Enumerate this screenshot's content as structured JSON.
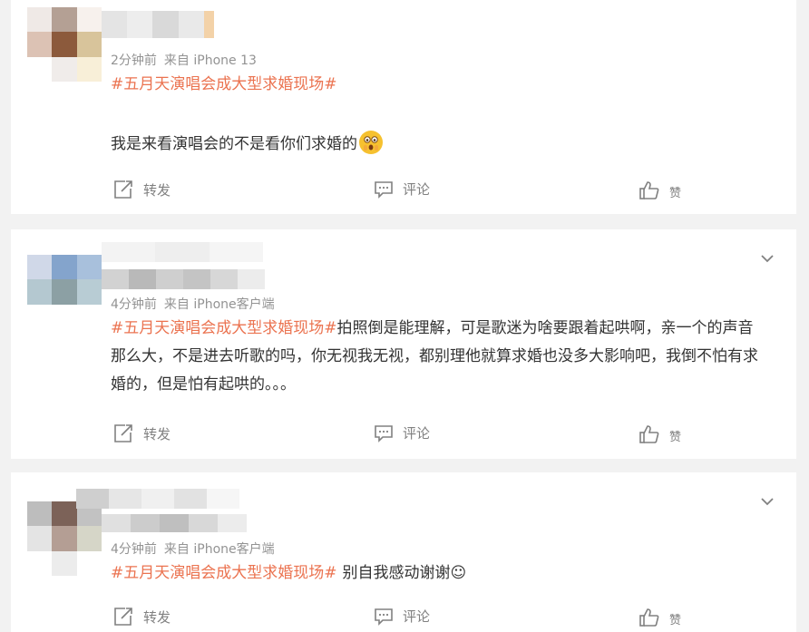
{
  "posts": [
    {
      "meta_time": "2分钟前",
      "meta_source": "来自 iPhone 13",
      "hashtag": "#五月天演唱会成大型求婚现场#",
      "text": "我是来看演唱会的不是看你们求婚的",
      "emoji": "scared-face-emoji",
      "actions": {
        "forward": "转发",
        "comment": "评论",
        "like": "赞"
      }
    },
    {
      "meta_time": "4分钟前",
      "meta_source": "来自 iPhone客户端",
      "hashtag": "#五月天演唱会成大型求婚现场#",
      "text": "拍照倒是能理解，可是歌迷为啥要跟着起哄啊，亲一个的声音那么大，不是进去听歌的吗，你无视我无视，都别理他就算求婚也没多大影响吧，我倒不怕有求婚的，但是怕有起哄的。。。",
      "actions": {
        "forward": "转发",
        "comment": "评论",
        "like": "赞"
      }
    },
    {
      "meta_time": "4分钟前",
      "meta_source": "来自 iPhone客户端",
      "hashtag": "#五月天演唱会成大型求婚现场#",
      "text": "别自我感动谢谢☺",
      "actions": {
        "forward": "转发",
        "comment": "评论",
        "like": "赞"
      }
    }
  ],
  "colors": {
    "hashtag": "#eb7350",
    "meta": "#939393",
    "action": "#808080",
    "background": "#f2f2f2"
  },
  "icons": [
    "forward-icon",
    "comment-icon",
    "like-icon",
    "chevron-down-icon"
  ]
}
